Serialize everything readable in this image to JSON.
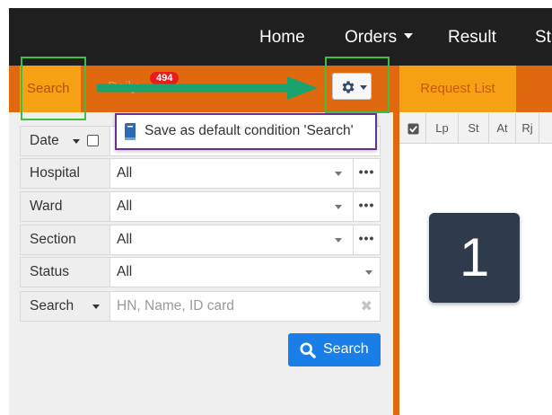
{
  "nav": {
    "home": "Home",
    "orders": "Orders",
    "result": "Result",
    "more": "St"
  },
  "tabs": {
    "search": "Search",
    "daily": "Daily",
    "daily_badge": "494",
    "request_list": "Request List"
  },
  "dropdown": {
    "save_default": "Save as default condition 'Search'"
  },
  "filters": {
    "date_label": "Date",
    "hospital_label": "Hospital",
    "hospital_value": "All",
    "ward_label": "Ward",
    "ward_value": "All",
    "section_label": "Section",
    "section_value": "All",
    "status_label": "Status",
    "status_value": "All",
    "search_label": "Search",
    "search_placeholder": "HN, Name, ID card"
  },
  "search_button": "Search",
  "request_columns": [
    "Lp",
    "St",
    "At",
    "Rj"
  ],
  "step_number": "1",
  "colors": {
    "topbar": "#1f1f1f",
    "orange": "#e0680f",
    "active_tab": "#f6a114",
    "badge": "#e81c1c",
    "primary_button": "#1a7ee8",
    "highlight_green": "#3fbf3f",
    "highlight_purple": "#6a2f8f",
    "arrow": "#1aa36e",
    "step_card": "#2f3a4d"
  },
  "icons": {
    "gear": "gear-icon",
    "search": "search-icon",
    "document": "document-icon",
    "clear": "clear-icon",
    "checkbox": "checkbox-icon"
  }
}
